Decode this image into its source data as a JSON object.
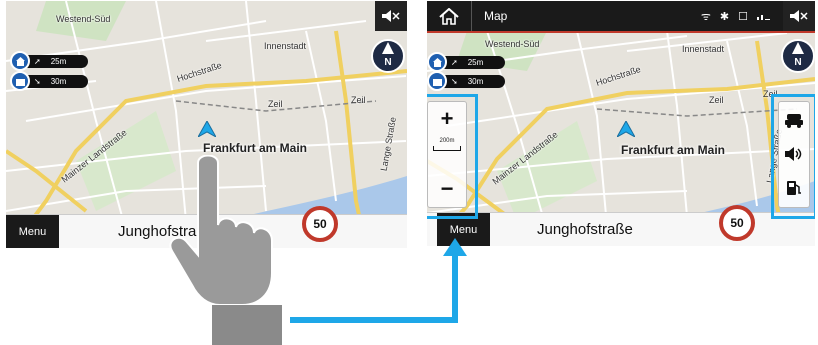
{
  "left_screen": {
    "mute_icon": "speaker-mute-icon",
    "compass_letter": "N",
    "favorites": [
      {
        "icon": "home-icon",
        "distance": "25m"
      },
      {
        "icon": "work-icon",
        "distance": "30m"
      }
    ],
    "map_labels": {
      "westend": "Westend-Süd",
      "innenstadt": "Innenstadt",
      "hochstrasse": "Hochstraße",
      "zeil_1": "Zeil",
      "zeil_2": "Zeil",
      "mainzer": "Mainzer Landstraße",
      "lange": "Lange Straße",
      "city": "Frankfurt am Main"
    },
    "menu_label": "Menu",
    "street_name": "Junghofstra",
    "speed_limit": "50"
  },
  "right_screen": {
    "header": {
      "title": "Map"
    },
    "compass_letter": "N",
    "favorites": [
      {
        "icon": "home-icon",
        "distance": "25m"
      },
      {
        "icon": "work-icon",
        "distance": "30m"
      }
    ],
    "map_labels": {
      "westend": "Westend-Süd",
      "innenstadt": "Innenstadt",
      "hochstrasse": "Hochstraße",
      "zeil_1": "Zeil",
      "zeil_2": "Zeil",
      "mainzer": "Mainzer Landstraße",
      "lange": "Lange Straße",
      "city": "Frankfurt am Main"
    },
    "zoom": {
      "plus": "+",
      "minus": "−",
      "scale": "200m"
    },
    "side_buttons": [
      "traffic-icon",
      "volume-icon",
      "fuel-icon"
    ],
    "menu_label": "Menu",
    "street_name": "Junghofstraße",
    "speed_limit": "50"
  },
  "colors": {
    "highlight": "#1ea7e8",
    "header_accent": "#c0392b",
    "fav_blue": "#1f5fb0",
    "river": "#aac8ea",
    "main_road": "#f0d060"
  }
}
